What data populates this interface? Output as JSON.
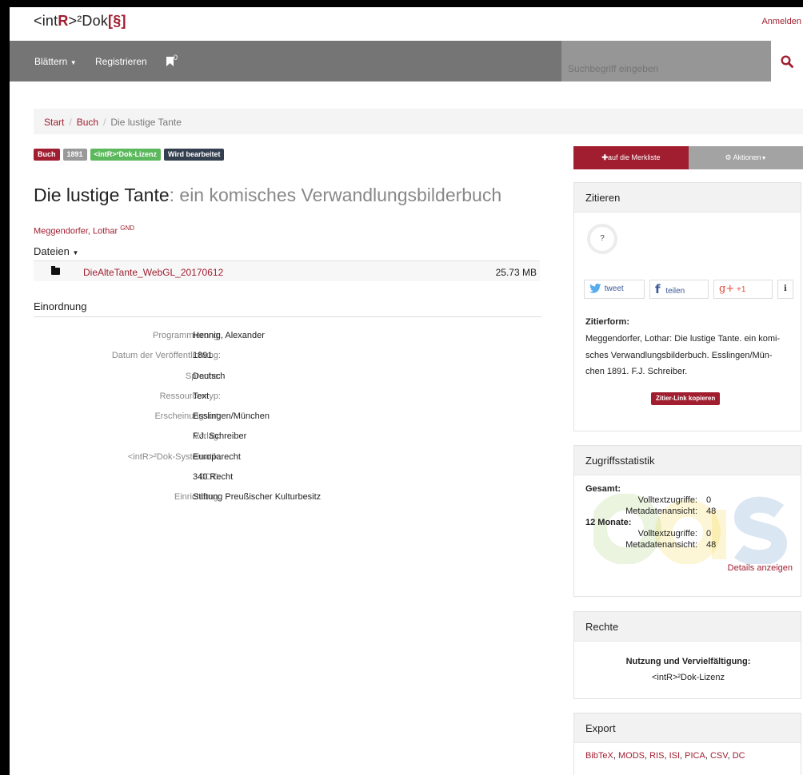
{
  "brand": {
    "prefix": "<int",
    "r": "R",
    "mid": ">²Dok",
    "sec": "[§]"
  },
  "header": {
    "login": "Anmelden"
  },
  "nav": {
    "browse": "Blättern",
    "register": "Registrieren",
    "bookmark_count": "0",
    "search_placeholder": "Suchbegriff eingeben"
  },
  "breadcrumb": {
    "start": "Start",
    "buch": "Buch",
    "current": "Die lustige Tante"
  },
  "badges": [
    {
      "label": "Buch",
      "color": "#a01e30"
    },
    {
      "label": "1891",
      "color": "#999999"
    },
    {
      "label": "<intR>²Dok-Lizenz",
      "color": "#5cb85c"
    },
    {
      "label": "Wird bearbeitet",
      "color": "#333f4f"
    }
  ],
  "record": {
    "title": "Die lustige Tante",
    "subtitle": ": ein komisches Verwandlungsbilderbuch",
    "author": "Meggendorfer, Lothar",
    "author_sup": "GND"
  },
  "files": {
    "heading": "Dateien",
    "items": [
      {
        "name": "DieAlteTante_WebGL_20170612",
        "size": "25.73 MB"
      }
    ]
  },
  "einordnung": {
    "heading": "Einordnung",
    "rows": [
      {
        "key": "Programmierung:",
        "value": "Hennig, Alexander",
        "link": true
      },
      {
        "key": "Datum der Veröffentlichung:",
        "value": "1891",
        "link": false
      },
      {
        "key": "Sprache:",
        "value": "Deutsch",
        "link": false
      },
      {
        "key": "Ressourcentyp:",
        "value": "Text",
        "link": false
      },
      {
        "key": "Erscheinungsort:",
        "value": "Esslingen/München",
        "link": false
      },
      {
        "key": "Verlag:",
        "value": "F.J. Schreiber",
        "link": false
      },
      {
        "key": "<intR>²Dok-Systematik:",
        "value": "Europarecht",
        "link": false
      },
      {
        "key": "DDC:",
        "value": "340 Recht",
        "link": false
      },
      {
        "key": "Einrichtung:",
        "value": "Stiftung Preußischer Kulturbesitz",
        "link": false
      }
    ]
  },
  "actions": {
    "merkliste": "auf die Merkliste",
    "aktionen": "Aktionen"
  },
  "zitieren": {
    "heading": "Zitieren",
    "circle": "?",
    "tweet": "tweet",
    "teilen": "teilen",
    "plus": "+1",
    "info": "i",
    "form_label": "Zitierform:",
    "form_text_lines": [
      "Meggendorfer, Lothar: Die lustige Tante. ein komi-",
      "sches Verwandlungsbilderbuch. Esslingen/Mün-",
      "chen 1891. F.J. Schreiber."
    ],
    "copy_button": "Zitier-Link kopieren"
  },
  "stats": {
    "heading": "Zugriffsstatistik",
    "total_label": "Gesamt:",
    "total": [
      {
        "key": "Volltextzugriffe:",
        "value": "0"
      },
      {
        "key": "Metadatenansicht:",
        "value": "48"
      }
    ],
    "months_label": "12 Monate:",
    "months": [
      {
        "key": "Volltextzugriffe:",
        "value": "0"
      },
      {
        "key": "Metadatenansicht:",
        "value": "48"
      }
    ],
    "details": "Details anzeigen"
  },
  "rechte": {
    "heading": "Rechte",
    "label": "Nutzung und Vervielfältigung:",
    "value": "<intR>²Dok-Lizenz"
  },
  "export": {
    "heading": "Export",
    "formats": [
      "BibTeX",
      "MODS",
      "RIS",
      "ISI",
      "PICA",
      "CSV",
      "DC"
    ]
  }
}
